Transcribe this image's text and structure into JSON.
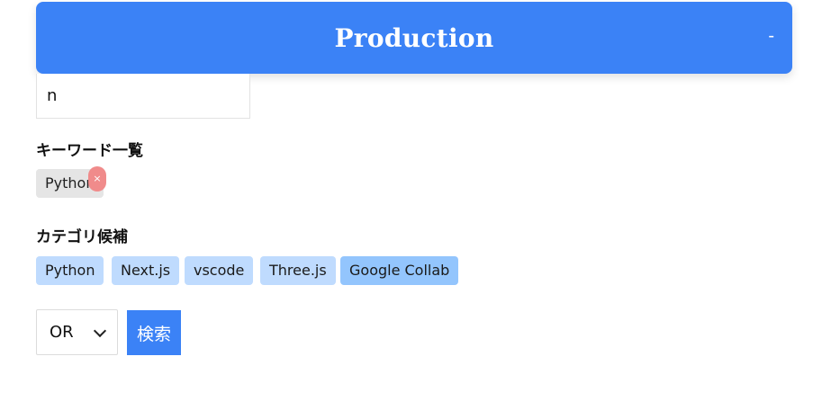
{
  "header": {
    "title": "Production",
    "toggle_label": "-"
  },
  "keyword_input": {
    "value": "n"
  },
  "keywords": {
    "label": "キーワード一覧",
    "items": [
      {
        "label": "Python",
        "remove_label": "×"
      }
    ]
  },
  "categories": {
    "label": "カテゴリ候補",
    "items": [
      {
        "label": "Python"
      },
      {
        "label": "Next.js"
      },
      {
        "label": "vscode"
      },
      {
        "label": "Three.js"
      },
      {
        "label": "Google Collab",
        "selected": true
      }
    ]
  },
  "search": {
    "mode_value": "OR",
    "button_label": "検索"
  },
  "colors": {
    "accent": "#3b82f6",
    "category_tag": "#bfdbfe",
    "category_tag_selected": "#93c5fd",
    "keyword_tag": "#e5e5e5",
    "remove_badge": "#f08b8b"
  }
}
